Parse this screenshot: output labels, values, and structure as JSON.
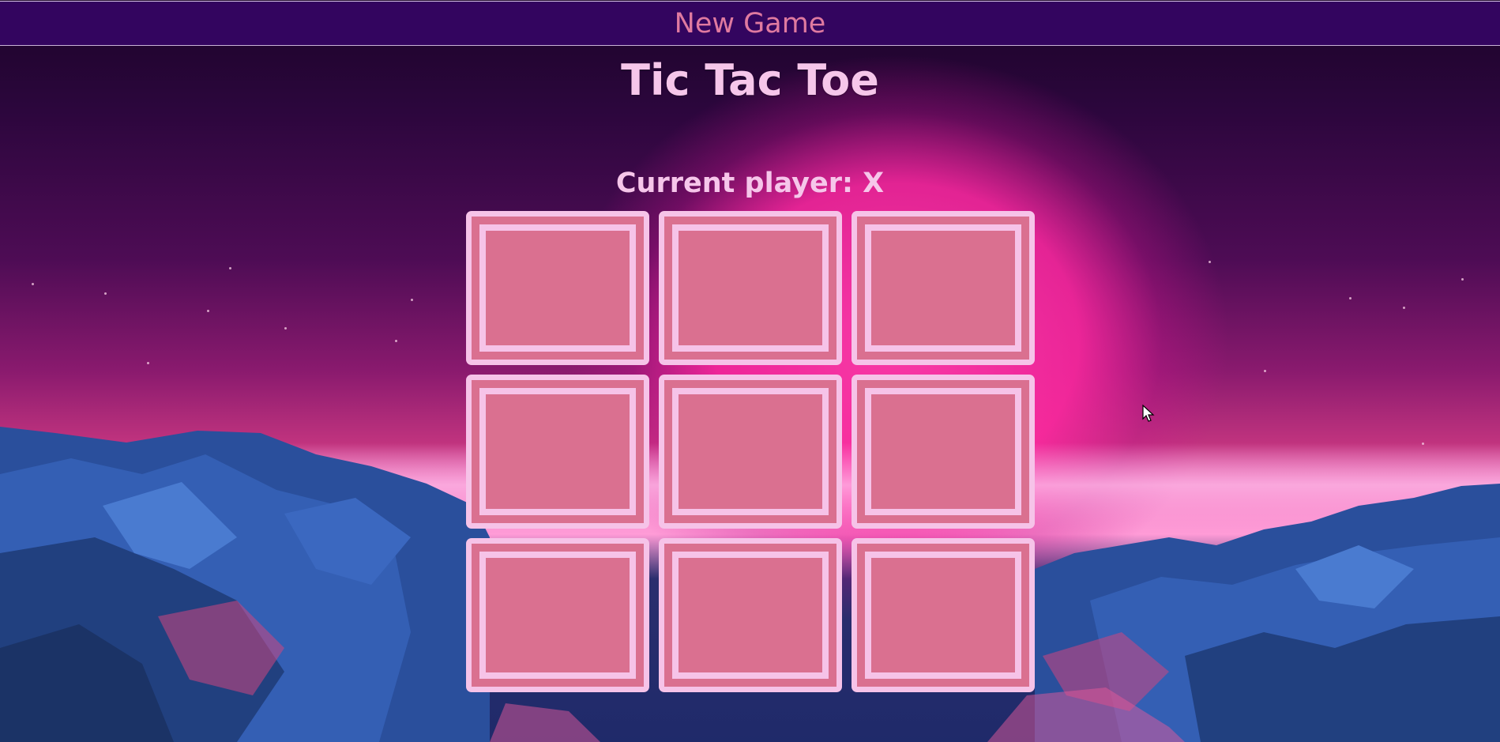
{
  "header": {
    "new_game_label": "New Game"
  },
  "title": "Tic Tac Toe",
  "status": {
    "current_player_text": "Current player: X"
  },
  "board": {
    "cells": [
      "",
      "",
      "",
      "",
      "",
      "",
      "",
      "",
      ""
    ]
  },
  "colors": {
    "topbar_bg": "#33055f",
    "topbar_text": "#e07aa0",
    "title_text": "#f6c6ea",
    "cell_frame": "#f6c3e8",
    "cell_fill": "#da7090"
  }
}
